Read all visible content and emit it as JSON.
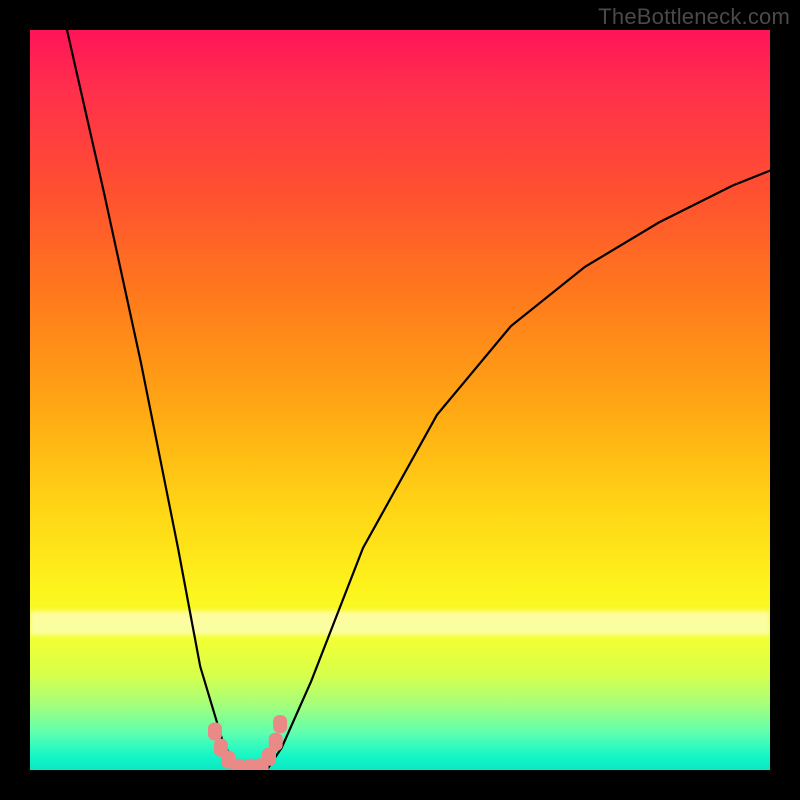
{
  "watermark": "TheBottleneck.com",
  "colors": {
    "frame_bg": "#000000",
    "curve_stroke": "#000000",
    "marker_fill": "#e98a86",
    "marker_stroke": "#e98a86"
  },
  "chart_data": {
    "type": "line",
    "title": "",
    "xlabel": "",
    "ylabel": "",
    "xlim": [
      0,
      100
    ],
    "ylim": [
      0,
      100
    ],
    "grid": false,
    "legend": false,
    "note": "V-shaped bottleneck curve on red-to-green vertical gradient; no axes or tick labels are rendered. Y value ≈ bottleneck magnitude (0 at bottom = no bottleneck, 100 at top). Curve minimum near x≈30.",
    "series": [
      {
        "name": "bottleneck-curve",
        "x": [
          5,
          10,
          15,
          20,
          23,
          26,
          28,
          30,
          32,
          34,
          38,
          45,
          55,
          65,
          75,
          85,
          95,
          100
        ],
        "y": [
          100,
          78,
          55,
          30,
          14,
          4,
          0,
          0,
          0,
          3,
          12,
          30,
          48,
          60,
          68,
          74,
          79,
          81
        ]
      }
    ],
    "markers": {
      "name": "highlight-dots",
      "note": "salmon rounded markers clustered at valley bottom",
      "x": [
        25.0,
        25.8,
        26.8,
        28.2,
        29.8,
        31.3,
        32.3,
        33.2,
        33.8
      ],
      "y": [
        5.2,
        3.0,
        1.4,
        0.3,
        0.3,
        0.4,
        1.8,
        3.8,
        6.2
      ]
    }
  }
}
